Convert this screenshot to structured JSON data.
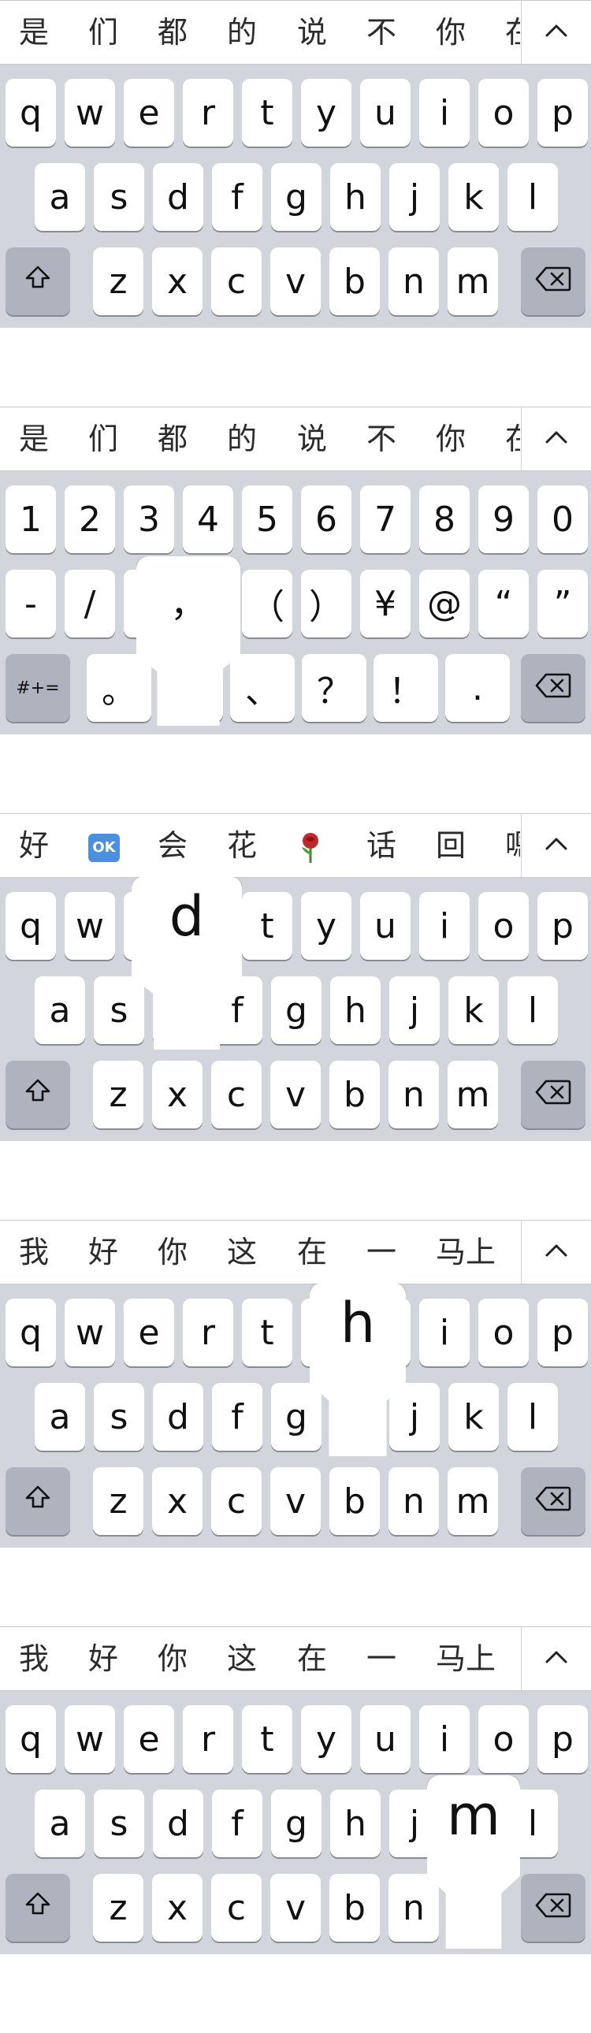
{
  "panels": [
    {
      "candidates": [
        "是",
        "们",
        "都",
        "的",
        "说",
        "不",
        "你",
        "在"
      ]
    },
    {
      "candidates": [
        "是",
        "们",
        "都",
        "的",
        "说",
        "不",
        "你",
        "在"
      ]
    },
    {
      "candidates": [
        "好",
        "OK",
        "会",
        "花",
        "rose",
        "话",
        "回",
        "嗯"
      ]
    },
    {
      "candidates": [
        "我",
        "好",
        "你",
        "这",
        "在",
        "一",
        "马上"
      ]
    },
    {
      "candidates": [
        "我",
        "好",
        "你",
        "这",
        "在",
        "一",
        "马上"
      ]
    }
  ],
  "letters": {
    "row1": [
      "q",
      "w",
      "e",
      "r",
      "t",
      "y",
      "u",
      "i",
      "o",
      "p"
    ],
    "row2": [
      "a",
      "s",
      "d",
      "f",
      "g",
      "h",
      "j",
      "k",
      "l"
    ],
    "row3": [
      "z",
      "x",
      "c",
      "v",
      "b",
      "n",
      "m"
    ]
  },
  "numbers": {
    "row1": [
      "1",
      "2",
      "3",
      "4",
      "5",
      "6",
      "7",
      "8",
      "9",
      "0"
    ],
    "row2": [
      "-",
      "/",
      "：",
      "；",
      "（",
      "）",
      "¥",
      "@",
      "“",
      "”"
    ],
    "row3_mode": "#+=",
    "row3": [
      "。",
      "，",
      "、",
      "？",
      "！",
      "."
    ]
  },
  "popups": [
    {
      "panel": 1,
      "char": "，"
    },
    {
      "panel": 2,
      "char": "d"
    },
    {
      "panel": 3,
      "char": "h"
    },
    {
      "panel": 4,
      "char": "m"
    }
  ],
  "icons": {
    "shift": "shift-icon",
    "delete": "delete-icon",
    "expand": "chevron-up-icon",
    "ok_emoji": "ok-emoji-icon",
    "rose_emoji": "rose-emoji-icon"
  },
  "colors": {
    "keyboard_bg": "#d2d5db",
    "key": "#ffffff",
    "special_key": "#aeb3bd"
  }
}
